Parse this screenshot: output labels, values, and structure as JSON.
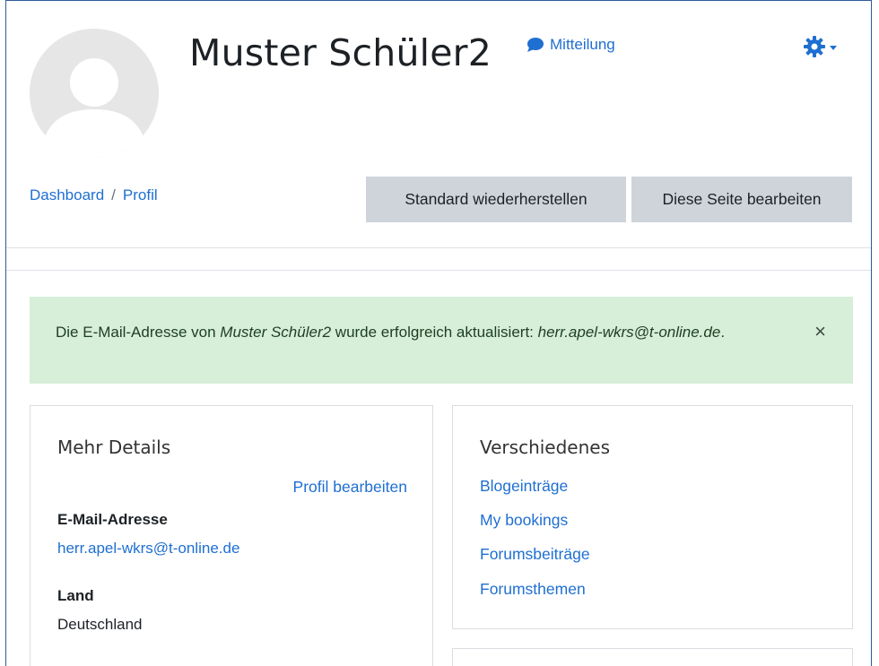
{
  "header": {
    "user_name": "Muster Schüler2",
    "message_label": "Mitteilung"
  },
  "breadcrumb": {
    "dashboard": "Dashboard",
    "separator": "/",
    "profile": "Profil"
  },
  "actions": {
    "reset_label": "Standard wiederherstellen",
    "edit_page_label": "Diese Seite bearbeiten"
  },
  "alert": {
    "prefix": "Die E-Mail-Adresse von ",
    "user": "Muster Schüler2",
    "middle": " wurde erfolgreich aktualisiert: ",
    "email": "herr.apel-wkrs@t-online.de",
    "suffix": ".",
    "close": "×"
  },
  "details": {
    "title": "Mehr Details",
    "edit_profile": "Profil bearbeiten",
    "email_label": "E-Mail-Adresse",
    "email_value": "herr.apel-wkrs@t-online.de",
    "country_label": "Land",
    "country_value": "Deutschland"
  },
  "misc": {
    "title": "Verschiedenes",
    "links": [
      "Blogeinträge",
      "My bookings",
      "Forumsbeiträge",
      "Forumsthemen"
    ]
  },
  "colors": {
    "link": "#1f6fd1",
    "button_bg": "#ced4da",
    "alert_bg": "#d7eed9"
  },
  "icons": {
    "message": "speech-bubble-icon",
    "settings": "gear-icon",
    "close": "close-icon",
    "avatar": "user-silhouette-icon"
  }
}
